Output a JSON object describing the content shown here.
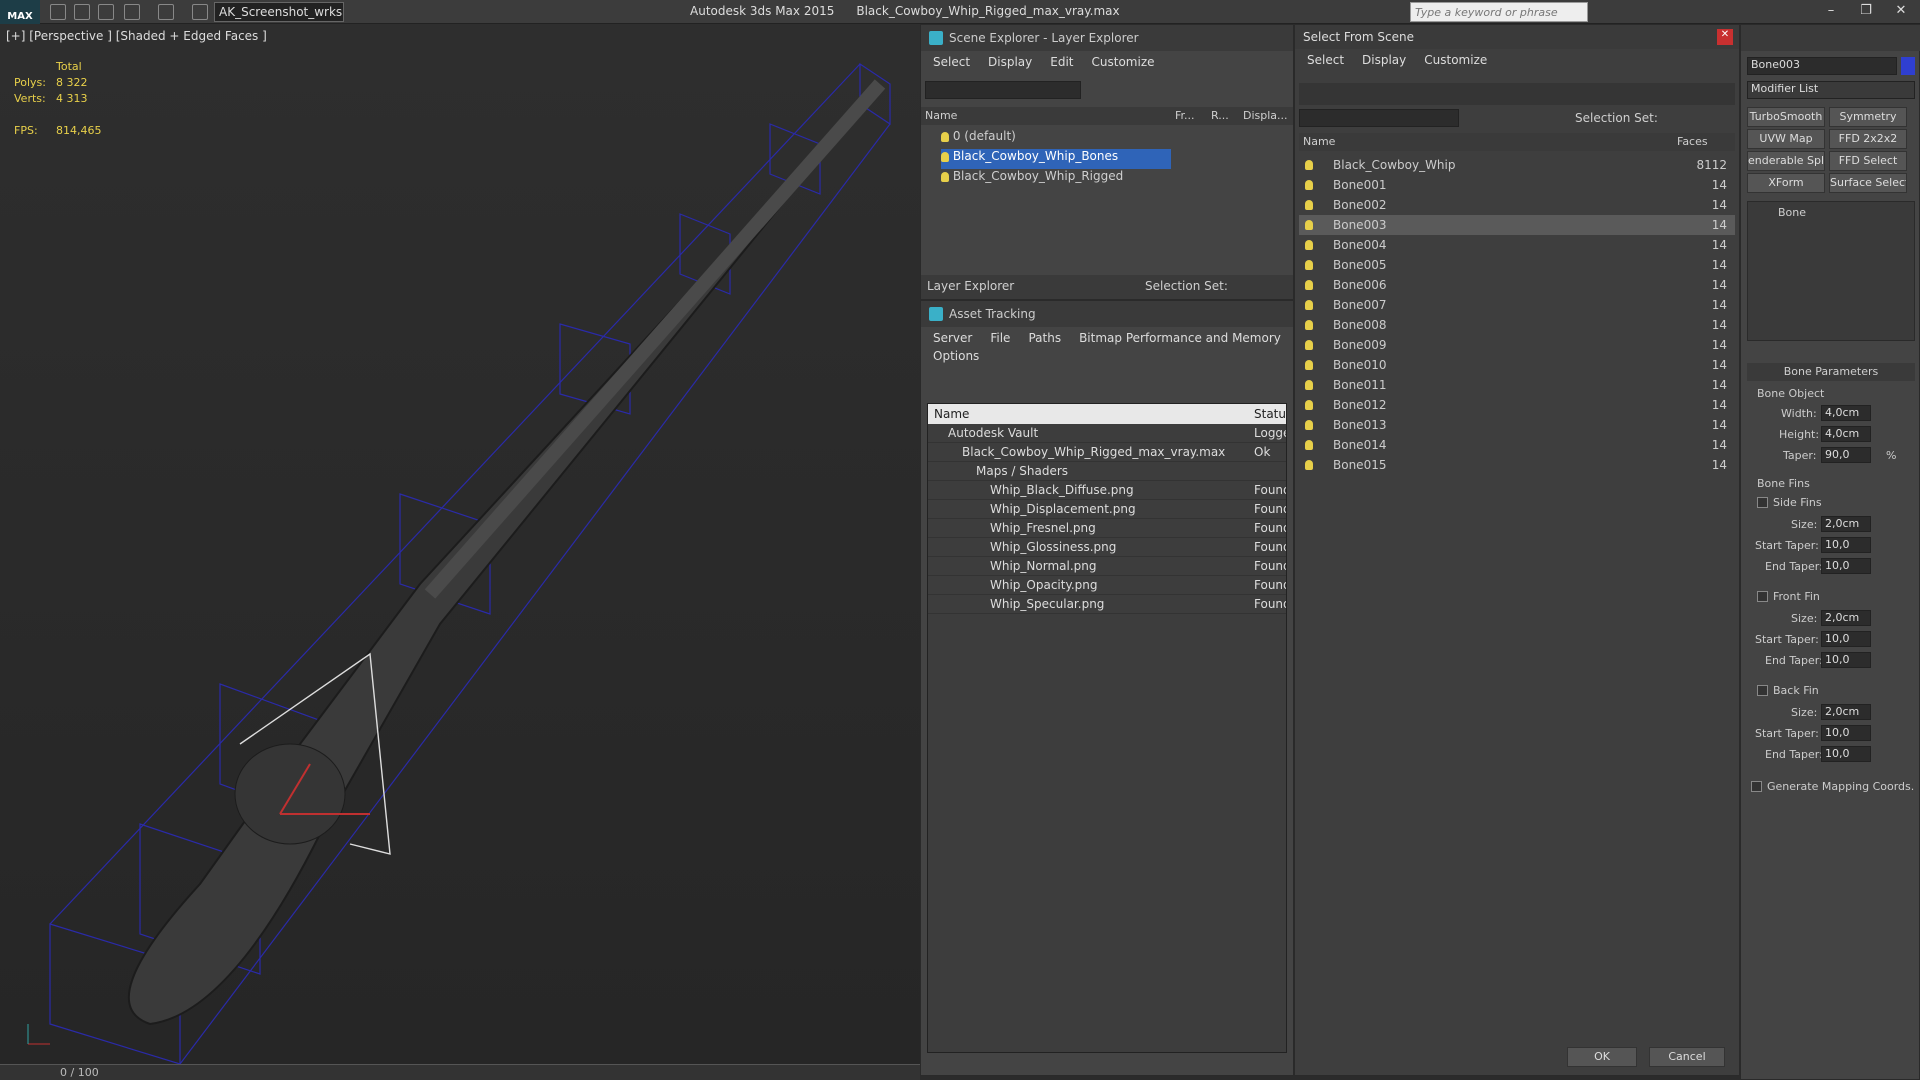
{
  "app": {
    "logo": "MAX",
    "workspace": "AK_Screenshot_wrksp",
    "title_app": "Autodesk 3ds Max  2015",
    "title_file": "Black_Cowboy_Whip_Rigged_max_vray.max",
    "search_placeholder": "Type a keyword or phrase"
  },
  "viewport": {
    "label": "[+] [Perspective ] [Shaded + Edged Faces ]",
    "stats": {
      "total": "Total",
      "polys_label": "Polys:",
      "polys": "8 322",
      "verts_label": "Verts:",
      "verts": "4 313",
      "fps_label": "FPS:",
      "fps": "814,465"
    },
    "frame": "0 / 100"
  },
  "scene_explorer": {
    "title": "Scene Explorer - Layer Explorer",
    "menu": [
      "Select",
      "Display",
      "Edit",
      "Customize"
    ],
    "columns": [
      "Name",
      "Fr...",
      "R...",
      "Displa..."
    ],
    "rows": [
      "0 (default)",
      "Black_Cowboy_Whip_Bones",
      "Black_Cowboy_Whip_Rigged"
    ],
    "footer_mode": "Layer Explorer",
    "selection_set": "Selection Set:"
  },
  "asset_tracking": {
    "title": "Asset Tracking",
    "menu": [
      "Server",
      "File",
      "Paths",
      "Bitmap Performance and Memory",
      "Options"
    ],
    "columns": [
      "Name",
      "Status"
    ],
    "rows": [
      {
        "name": "Autodesk Vault",
        "status": "Logged"
      },
      {
        "name": "Black_Cowboy_Whip_Rigged_max_vray.max",
        "status": "Ok"
      },
      {
        "name": "Maps / Shaders",
        "status": ""
      },
      {
        "name": "Whip_Black_Diffuse.png",
        "status": "Found"
      },
      {
        "name": "Whip_Displacement.png",
        "status": "Found"
      },
      {
        "name": "Whip_Fresnel.png",
        "status": "Found"
      },
      {
        "name": "Whip_Glossiness.png",
        "status": "Found"
      },
      {
        "name": "Whip_Normal.png",
        "status": "Found"
      },
      {
        "name": "Whip_Opacity.png",
        "status": "Found"
      },
      {
        "name": "Whip_Specular.png",
        "status": "Found"
      }
    ]
  },
  "select_scene": {
    "title": "Select From Scene",
    "menu": [
      "Select",
      "Display",
      "Customize"
    ],
    "selection_set": "Selection Set:",
    "columns": [
      "Name",
      "Faces"
    ],
    "rows": [
      {
        "name": "Black_Cowboy_Whip",
        "faces": "8112"
      },
      {
        "name": "Bone001",
        "faces": "14"
      },
      {
        "name": "Bone002",
        "faces": "14"
      },
      {
        "name": "Bone003",
        "faces": "14"
      },
      {
        "name": "Bone004",
        "faces": "14"
      },
      {
        "name": "Bone005",
        "faces": "14"
      },
      {
        "name": "Bone006",
        "faces": "14"
      },
      {
        "name": "Bone007",
        "faces": "14"
      },
      {
        "name": "Bone008",
        "faces": "14"
      },
      {
        "name": "Bone009",
        "faces": "14"
      },
      {
        "name": "Bone010",
        "faces": "14"
      },
      {
        "name": "Bone011",
        "faces": "14"
      },
      {
        "name": "Bone012",
        "faces": "14"
      },
      {
        "name": "Bone013",
        "faces": "14"
      },
      {
        "name": "Bone014",
        "faces": "14"
      },
      {
        "name": "Bone015",
        "faces": "14"
      }
    ],
    "ok": "OK",
    "cancel": "Cancel"
  },
  "command_panel": {
    "object_name": "Bone003",
    "modifier_list": "Modifier List",
    "buttons": [
      "TurboSmooth",
      "Symmetry",
      "UVW Map",
      "FFD 2x2x2",
      "enderable Splin",
      "FFD Select",
      "XForm",
      "Surface Select"
    ],
    "stack_item": "Bone",
    "rollout": "Bone Parameters",
    "bone_object": "Bone Object",
    "width_label": "Width:",
    "width": "4,0cm",
    "height_label": "Height:",
    "height": "4,0cm",
    "taper_label": "Taper:",
    "taper": "90,0",
    "bone_fins": "Bone Fins",
    "side_fins": "Side Fins",
    "front_fin": "Front Fin",
    "back_fin": "Back Fin",
    "size_label": "Size:",
    "size": "2,0cm",
    "start_taper_label": "Start Taper:",
    "end_taper_label": "End Taper:",
    "taper_val": "10,0",
    "pct": "%",
    "gen_mapping": "Generate Mapping Coords."
  }
}
